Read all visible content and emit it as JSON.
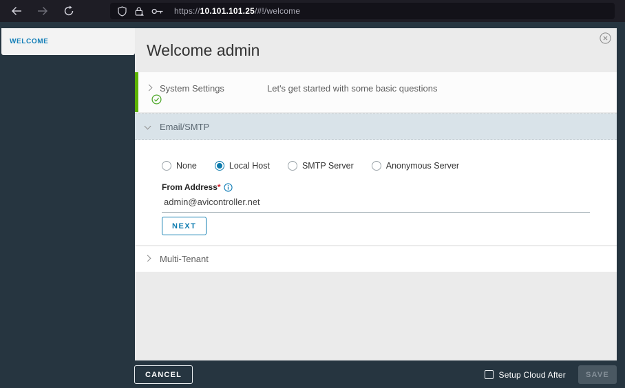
{
  "browser": {
    "url": {
      "scheme": "https://",
      "host": "10.101.101.25",
      "path": "/#!/welcome"
    }
  },
  "sidebar": {
    "active_item": "WELCOME"
  },
  "modal": {
    "title": "Welcome admin",
    "sections": {
      "system_settings": {
        "title": "System Settings",
        "subtitle": "Let's get started with some basic questions",
        "state": "collapsed",
        "completed": true
      },
      "email_smtp": {
        "title": "Email/SMTP",
        "state": "expanded"
      },
      "multi_tenant": {
        "title": "Multi-Tenant",
        "state": "collapsed"
      }
    },
    "email_smtp": {
      "radio_options": [
        "None",
        "Local Host",
        "SMTP Server",
        "Anonymous Server"
      ],
      "selected_option": "Local Host",
      "from_address_label": "From Address",
      "required_marker": "*",
      "from_address_value": "admin@avicontroller.net",
      "next_label": "NEXT"
    }
  },
  "footer": {
    "cancel_label": "CANCEL",
    "checkbox_label": "Setup Cloud After",
    "checkbox_checked": false,
    "save_label": "SAVE",
    "save_enabled": false
  },
  "colors": {
    "accent_blue": "#147FB8",
    "radio_blue": "#0B7AAC",
    "button_blue": "#0E7CB0",
    "success_green": "#5CB200",
    "dark_bg": "#263540",
    "section_header_bg": "#D9E3E9",
    "required_red": "#D9232E"
  },
  "icons": {
    "back": "left-arrow",
    "forward": "right-arrow",
    "reload": "circular-arrow",
    "shield": "tracking-protection",
    "lock": "connection-security",
    "key": "passkey",
    "chevron_right": "collapsed",
    "chevron_down": "expanded",
    "check_circle": "section-complete",
    "info": "field-help",
    "close": "dismiss-modal"
  }
}
